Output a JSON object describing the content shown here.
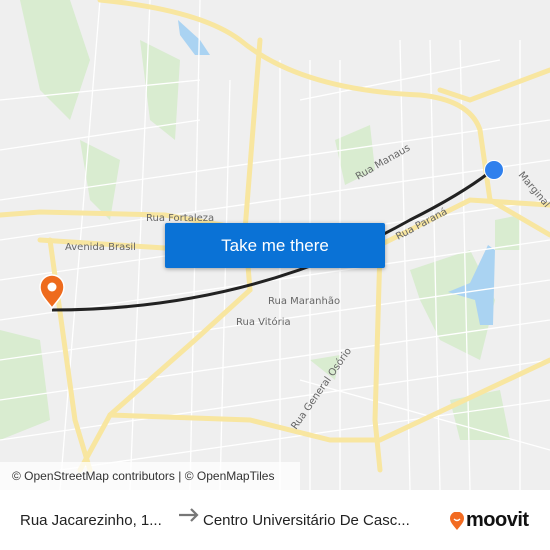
{
  "map": {
    "street_labels": [
      "Rua Manaus",
      "Marginal",
      "Rua Fortaleza",
      "Avenida Brasil",
      "Rua Paraná",
      "Rua Maranhão",
      "Rua Vitória",
      "Rua General Osório"
    ],
    "attribution": "© OpenStreetMap contributors | © OpenMapTiles",
    "origin_marker_color": "#ee6b1d",
    "destination_marker_color": "#2f80ed",
    "route_color": "#222222"
  },
  "cta": {
    "label": "Take me there"
  },
  "footer": {
    "from": "Rua Jacarezinho, 1...",
    "arrow_icon": "arrow-right-icon",
    "to": "Centro Universitário De Casc...",
    "brand": "moovit"
  }
}
